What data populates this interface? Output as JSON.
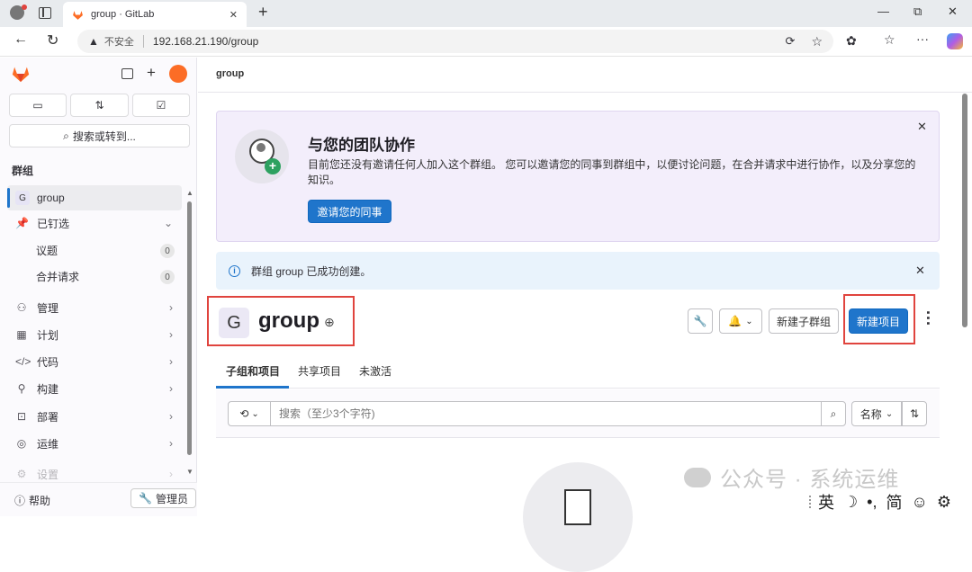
{
  "browser": {
    "tab_title": "group · GitLab",
    "new_tab": "+",
    "security_label": "不安全",
    "url": "192.168.21.190/group",
    "window_controls": {
      "minimize": "—",
      "restore": "⧉",
      "close": "✕"
    }
  },
  "sidebar": {
    "search_label": "搜索或转到...",
    "section_title": "群组",
    "group_item": {
      "avatar": "G",
      "label": "group"
    },
    "pinned": {
      "label": "已钉选",
      "items": [
        {
          "label": "议题",
          "count": "0"
        },
        {
          "label": "合并请求",
          "count": "0"
        }
      ]
    },
    "nav": [
      {
        "label": "管理",
        "icon": "users-icon"
      },
      {
        "label": "计划",
        "icon": "calendar-icon"
      },
      {
        "label": "代码",
        "icon": "code-icon"
      },
      {
        "label": "构建",
        "icon": "rocket-icon"
      },
      {
        "label": "部署",
        "icon": "deploy-icon"
      },
      {
        "label": "运维",
        "icon": "monitor-icon"
      },
      {
        "label": "设置",
        "icon": "settings-icon"
      }
    ],
    "help_label": "帮助",
    "admin_label": "管理员"
  },
  "main": {
    "breadcrumb": "group",
    "invite_banner": {
      "title": "与您的团队协作",
      "body": "目前您还没有邀请任何人加入这个群组。 您可以邀请您的同事到群组中，以便讨论问题，在合并请求中进行协作，以及分享您的知识。",
      "button": "邀请您的同事"
    },
    "alert": {
      "text": "群组 group 已成功创建。"
    },
    "group_header": {
      "avatar": "G",
      "name": "group",
      "new_subgroup": "新建子群组",
      "new_project": "新建项目"
    },
    "tabs": [
      "子组和项目",
      "共享项目",
      "未激活"
    ],
    "filter": {
      "search_placeholder": "搜索（至少3个字符)",
      "sort_label": "名称"
    }
  },
  "overlay": {
    "watermark": "公众号 · 系统运维",
    "ime": [
      "英",
      "☽",
      "•,",
      "简",
      "☺",
      "⚙"
    ]
  },
  "colors": {
    "primary": "#1f75cb",
    "banner_bg": "#f3eefb",
    "alert_bg": "#e9f3fc",
    "highlight": "#e0443e",
    "gitlab_orange": "#fc6d26"
  }
}
